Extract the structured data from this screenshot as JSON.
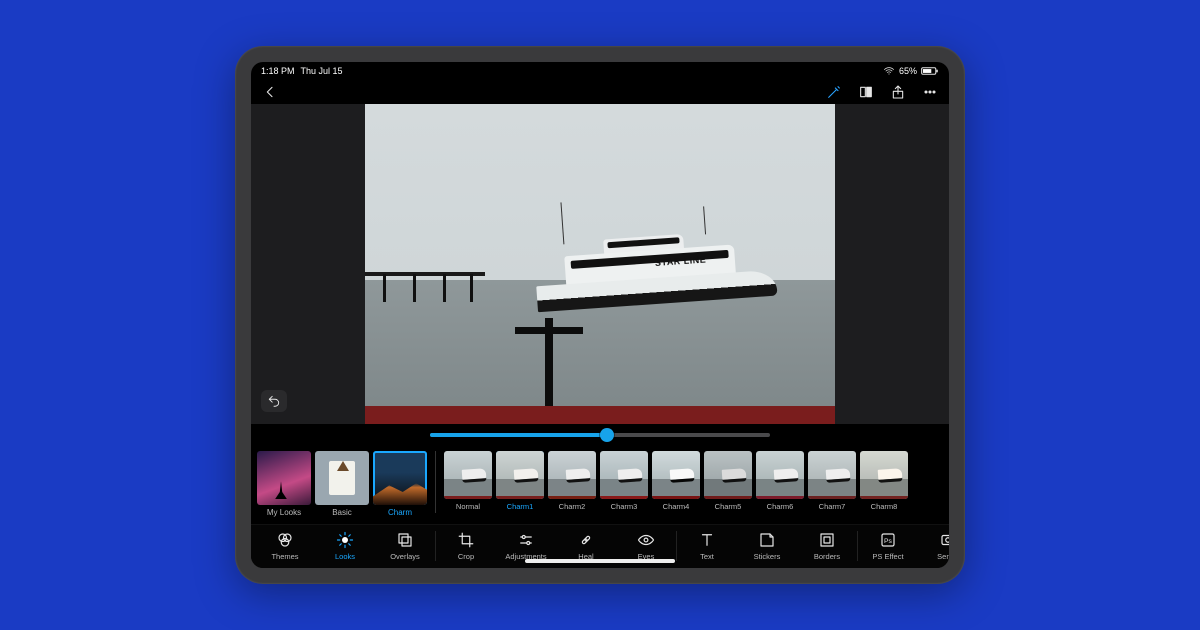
{
  "status": {
    "time": "1:18 PM",
    "date": "Thu Jul 15",
    "battery": "65%"
  },
  "toolbar": {
    "back_icon": "chevron-left",
    "actions": [
      "auto-enhance",
      "compare",
      "share",
      "more"
    ]
  },
  "photo": {
    "boat_name": "STAR LINE"
  },
  "slider": {
    "percent": 52
  },
  "categories": [
    {
      "id": "mylooks",
      "label": "My Looks"
    },
    {
      "id": "basic",
      "label": "Basic"
    },
    {
      "id": "charm",
      "label": "Charm",
      "selected": true
    }
  ],
  "presets": [
    {
      "label": "Normal"
    },
    {
      "label": "Charm1",
      "selected": true
    },
    {
      "label": "Charm2"
    },
    {
      "label": "Charm3"
    },
    {
      "label": "Charm4"
    },
    {
      "label": "Charm5"
    },
    {
      "label": "Charm6"
    },
    {
      "label": "Charm7"
    },
    {
      "label": "Charm8"
    }
  ],
  "tooltabs": [
    {
      "id": "themes",
      "label": "Themes"
    },
    {
      "id": "looks",
      "label": "Looks",
      "active": true
    },
    {
      "id": "overlays",
      "label": "Overlays"
    },
    {
      "id": "crop",
      "label": "Crop",
      "sep_before": true
    },
    {
      "id": "adjust",
      "label": "Adjustments"
    },
    {
      "id": "heal",
      "label": "Heal"
    },
    {
      "id": "eyes",
      "label": "Eyes"
    },
    {
      "id": "text",
      "label": "Text",
      "sep_before": true
    },
    {
      "id": "stickers",
      "label": "Stickers"
    },
    {
      "id": "borders",
      "label": "Borders"
    },
    {
      "id": "pseffect",
      "label": "PS Effect",
      "sep_before": true
    },
    {
      "id": "send",
      "label": "Send t"
    }
  ],
  "colors": {
    "accent": "#1aa8ff"
  }
}
